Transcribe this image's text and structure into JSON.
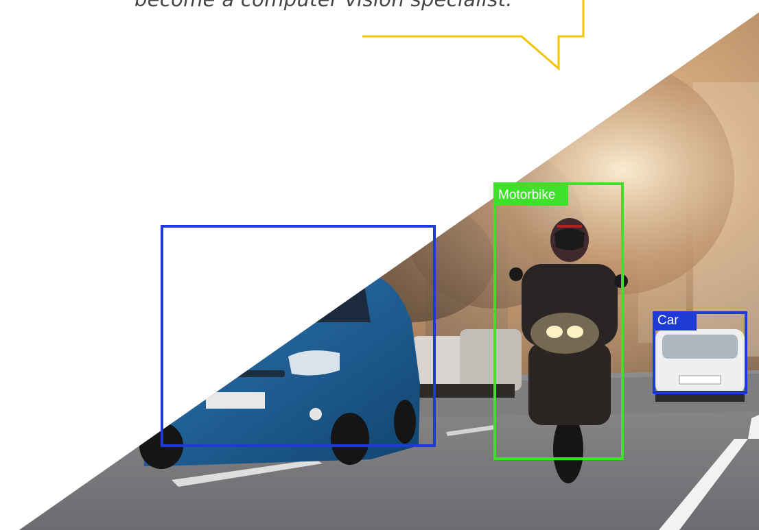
{
  "caption": {
    "text": "become a computer vision specialist."
  },
  "detections": [
    {
      "label": "Motorbike",
      "color": "#3ee02a"
    },
    {
      "label": "Car",
      "color": "#1f3bd6"
    },
    {
      "label": "",
      "color": "#1f3bd6"
    }
  ],
  "colors": {
    "bubble_outline": "#f2c500",
    "background": "#ffffff"
  }
}
